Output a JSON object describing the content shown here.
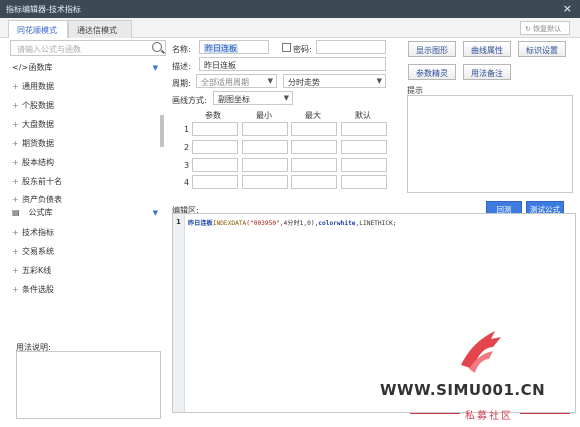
{
  "window": {
    "title": "指标编辑器-技术指标",
    "close": "×"
  },
  "tabs": [
    {
      "label": "同花顺模式"
    },
    {
      "label": "通达信模式"
    }
  ],
  "restore_button": "↻ 恢复默认",
  "search": {
    "placeholder": "请输入公式与函数"
  },
  "tree": {
    "function_lib": "函数库",
    "function_items": [
      "通用数据",
      "个股数据",
      "大盘数据",
      "期货数据",
      "股本结构",
      "股东前十名",
      "资产负债表"
    ],
    "formula_lib": "公式库",
    "formula_items": [
      "技术指标",
      "交易系统",
      "五彩K线",
      "条件选股"
    ]
  },
  "usage_label": "用法说明:",
  "form": {
    "name_label": "名称:",
    "name_value": "昨日连板",
    "password_label": "密码:",
    "desc_label": "描述:",
    "desc_value": "昨日连板",
    "period_label": "周期:",
    "period_value": "全部适用周期",
    "trend_value": "分时走势",
    "draw_label": "画线方式:",
    "draw_value": "副图坐标"
  },
  "params": {
    "headers": [
      "参数",
      "最小",
      "最大",
      "默认"
    ],
    "rows": [
      "1",
      "2",
      "3",
      "4"
    ]
  },
  "buttons": {
    "show_graph": "显示图形",
    "curve_attr": "曲线属性",
    "mark_setting": "标识设置",
    "param_tune": "参数精灵",
    "usage_note": "用法备注"
  },
  "hint_label": "提示",
  "editor": {
    "label": "编辑区:",
    "run": "回测",
    "test": "测试公式",
    "line_no": "1",
    "code": {
      "name": "昨日连板",
      "func": "INDEXDATA",
      "arg1": "(\"003950\",",
      "arg2": "4分时1,0),",
      "color": "colorwhite",
      "sep": ",",
      "tick": "LINETHICK;"
    }
  },
  "watermark": {
    "text": "WWW.SIMU001.CN",
    "sub": "私募社区"
  }
}
